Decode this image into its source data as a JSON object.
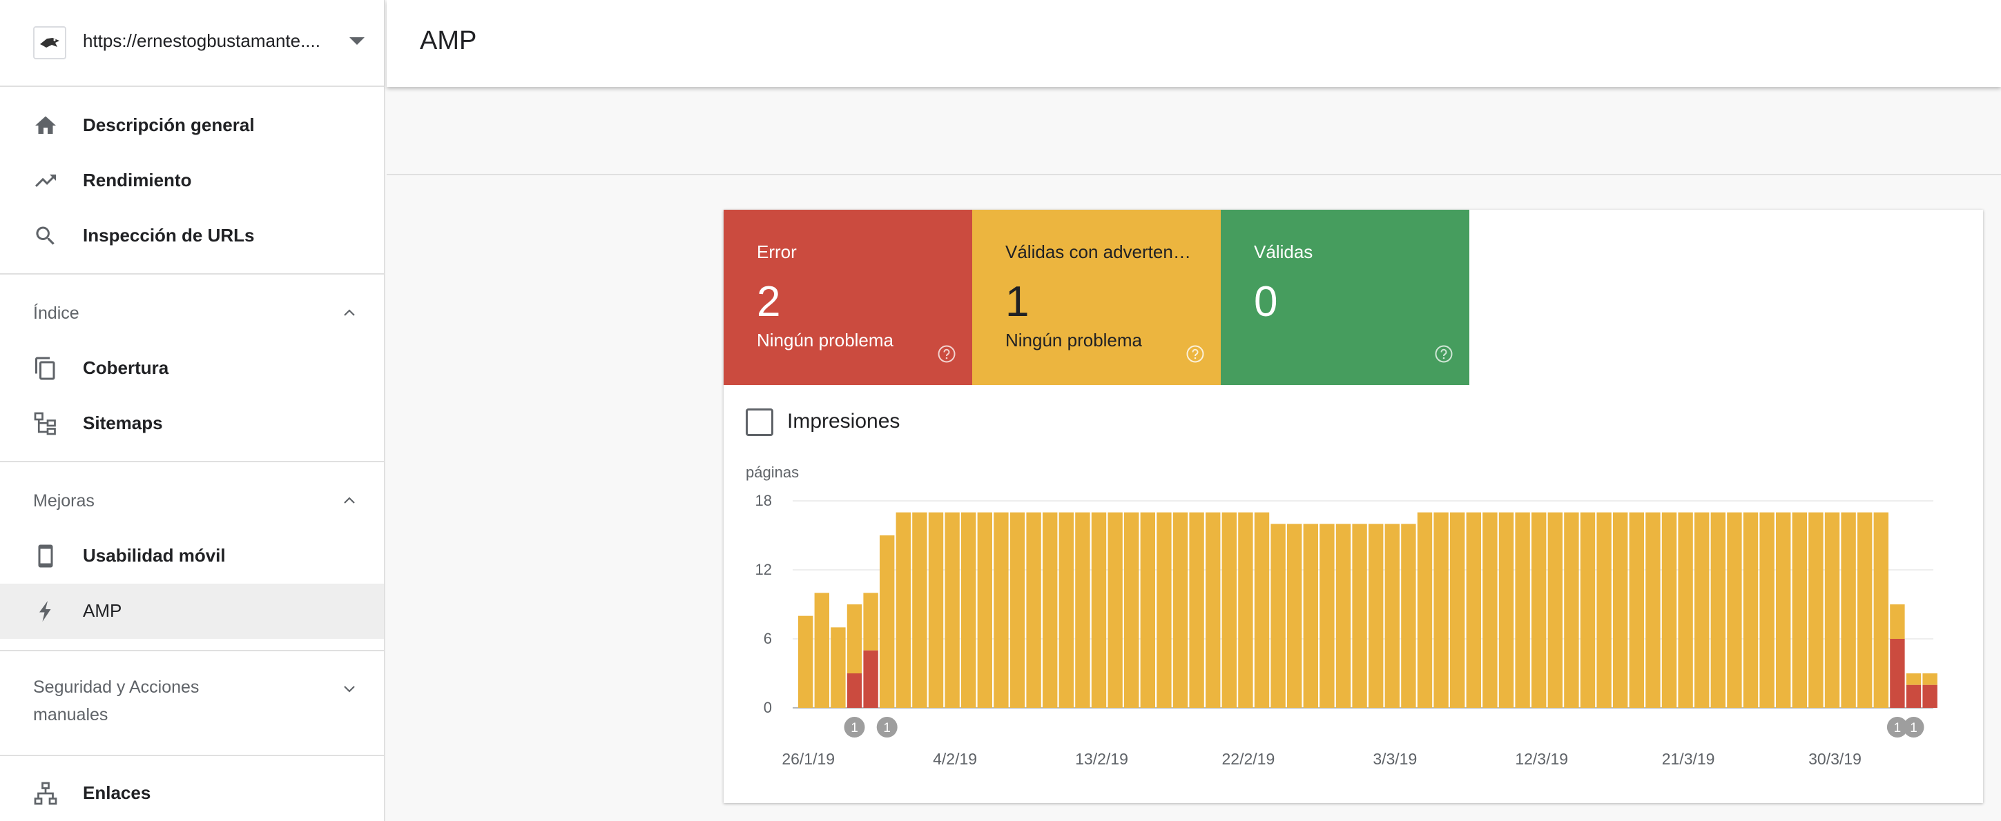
{
  "property": {
    "url": "https://ernestogbustamante...."
  },
  "sidebar": {
    "top_items": [
      {
        "label": "Descripción general",
        "icon": "home-icon"
      },
      {
        "label": "Rendimiento",
        "icon": "trending-up-icon"
      },
      {
        "label": "Inspección de URLs",
        "icon": "search-icon"
      }
    ],
    "sections": [
      {
        "title": "Índice",
        "expanded": true,
        "items": [
          {
            "label": "Cobertura",
            "icon": "copy-pages-icon"
          },
          {
            "label": "Sitemaps",
            "icon": "sitemap-icon"
          }
        ]
      },
      {
        "title": "Mejoras",
        "expanded": true,
        "items": [
          {
            "label": "Usabilidad móvil",
            "icon": "smartphone-icon"
          },
          {
            "label": "AMP",
            "icon": "flash-icon",
            "active": true
          }
        ]
      },
      {
        "title": "Seguridad y Acciones manuales",
        "expanded": false,
        "items": []
      }
    ],
    "bottom_items": [
      {
        "label": "Enlaces",
        "icon": "links-hierarchy-icon"
      }
    ]
  },
  "header": {
    "title": "AMP"
  },
  "summary_tiles": [
    {
      "label": "Error",
      "value": "2",
      "sub": "Ningún problema",
      "color": "#cb4b3f"
    },
    {
      "label": "Válidas con adverten…",
      "value": "1",
      "sub": "Ningún problema",
      "color": "#ecb53f"
    },
    {
      "label": "Válidas",
      "value": "0",
      "sub": "",
      "color": "#469d5e"
    }
  ],
  "impressions": {
    "label": "Impresiones",
    "checked": false
  },
  "chart_data": {
    "type": "bar",
    "stacked": true,
    "ylabel": "páginas",
    "ylim": [
      0,
      18
    ],
    "yticks": [
      0,
      6,
      12,
      18
    ],
    "xtick_labels": [
      "26/1/19",
      "4/2/19",
      "13/2/19",
      "22/2/19",
      "3/3/19",
      "12/3/19",
      "21/3/19",
      "30/3/19"
    ],
    "xtick_indices": [
      0,
      9,
      18,
      27,
      36,
      45,
      54,
      63
    ],
    "series": [
      {
        "color": "#cb4b3f",
        "values": [
          0,
          0,
          0,
          3,
          5,
          0,
          0,
          0,
          0,
          0,
          0,
          0,
          0,
          0,
          0,
          0,
          0,
          0,
          0,
          0,
          0,
          0,
          0,
          0,
          0,
          0,
          0,
          0,
          0,
          0,
          0,
          0,
          0,
          0,
          0,
          0,
          0,
          0,
          0,
          0,
          0,
          0,
          0,
          0,
          0,
          0,
          0,
          0,
          0,
          0,
          0,
          0,
          0,
          0,
          0,
          0,
          0,
          0,
          0,
          0,
          0,
          0,
          0,
          0,
          0,
          0,
          0,
          6,
          2,
          2
        ]
      },
      {
        "color": "#ecb53f",
        "values": [
          8,
          10,
          7,
          6,
          5,
          15,
          17,
          17,
          17,
          17,
          17,
          17,
          17,
          17,
          17,
          17,
          17,
          17,
          17,
          17,
          17,
          17,
          17,
          17,
          17,
          17,
          17,
          17,
          17,
          16,
          16,
          16,
          16,
          16,
          16,
          16,
          16,
          16,
          17,
          17,
          17,
          17,
          17,
          17,
          17,
          17,
          17,
          17,
          17,
          17,
          17,
          17,
          17,
          17,
          17,
          17,
          17,
          17,
          17,
          17,
          17,
          17,
          17,
          17,
          17,
          17,
          17,
          3,
          1,
          1
        ]
      }
    ],
    "annotations": [
      {
        "index": 3,
        "label": "1"
      },
      {
        "index": 5,
        "label": "1"
      },
      {
        "index": 67,
        "label": "1"
      },
      {
        "index": 68,
        "label": "1"
      }
    ],
    "grid": true
  }
}
